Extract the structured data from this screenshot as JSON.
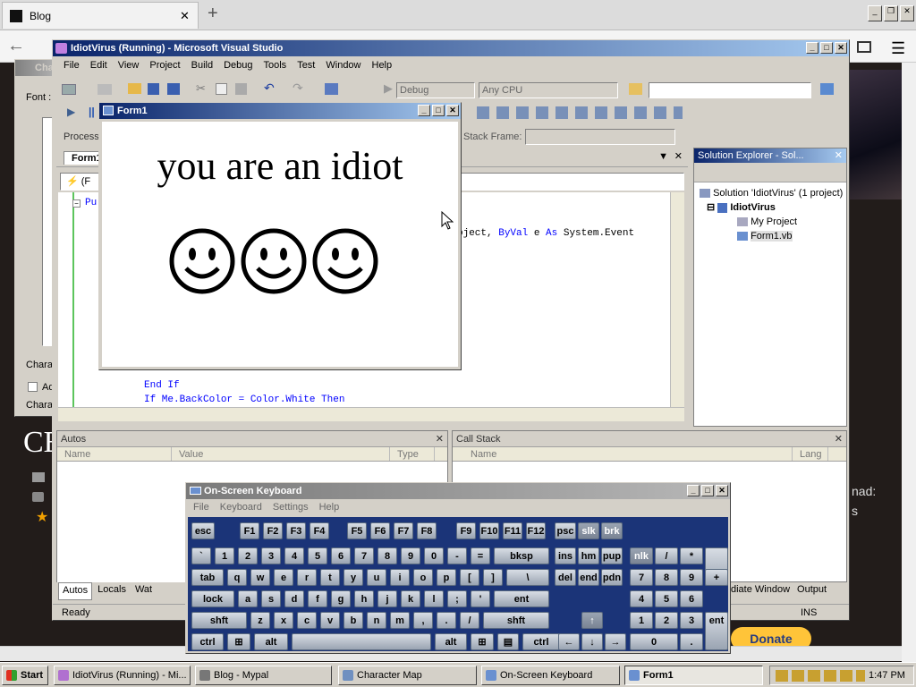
{
  "browser": {
    "tab_title": "Blog",
    "tab_close": "✕",
    "new_tab": "+",
    "back": "←",
    "win_controls": [
      "_",
      "❐",
      "✕"
    ]
  },
  "background_page": {
    "heading_fragment": "CE",
    "text_fragment_1": "nad:",
    "text_fragment_2": "s",
    "donate_label": "Donate"
  },
  "charmap": {
    "title": "Cha",
    "font_label": "Font :",
    "chars_label": "Chara",
    "adv_label": "Ad",
    "chars_label2": "Chara"
  },
  "vs": {
    "title": "IdiotVirus (Running) - Microsoft Visual Studio",
    "menu": [
      "File",
      "Edit",
      "View",
      "Project",
      "Build",
      "Debug",
      "Tools",
      "Test",
      "Window",
      "Help"
    ],
    "config": "Debug",
    "platform": "Any CPU",
    "process_label": "Process",
    "stack_frame_label": "Stack Frame:",
    "editor_tab": "Form1",
    "member_dropdown": "(F",
    "code_lines": [
      {
        "text": "Pu",
        "kw": true
      },
      {
        "text": "oject, ",
        "tail": "ByVal",
        "tail2": " e ",
        "tail3": "As",
        "tail4": " System.Event"
      },
      {
        "text": "End If"
      },
      {
        "text": "If Me.BackColor = Color.White Then"
      }
    ],
    "solution_explorer": {
      "title": "Solution Explorer - Sol...",
      "solution": "Solution 'IdiotVirus' (1 project)",
      "project": "IdiotVirus",
      "items": [
        "My Project",
        "Form1.vb"
      ]
    },
    "autos": {
      "title": "Autos",
      "columns": [
        "Name",
        "Value",
        "Type"
      ],
      "tabs": [
        "Autos",
        "Locals",
        "Wat"
      ]
    },
    "callstack": {
      "title": "Call Stack",
      "columns": [
        "Name",
        "Lang"
      ],
      "tabs": [
        "diate Window",
        "Output"
      ]
    },
    "status": "Ready",
    "ins": "INS"
  },
  "form1": {
    "title": "Form1",
    "message": "you are an idiot",
    "smileys": [
      "☺",
      "☺",
      "☺"
    ]
  },
  "osk": {
    "title": "On-Screen Keyboard",
    "menu": [
      "File",
      "Keyboard",
      "Settings",
      "Help"
    ],
    "rows": [
      [
        "esc",
        "F1",
        "F2",
        "F3",
        "F4",
        "F5",
        "F6",
        "F7",
        "F8",
        "F9",
        "F10",
        "F11",
        "F12",
        "psc",
        "slk",
        "brk"
      ],
      [
        "`",
        "1",
        "2",
        "3",
        "4",
        "5",
        "6",
        "7",
        "8",
        "9",
        "0",
        "-",
        "=",
        "bksp",
        "ins",
        "hm",
        "pup",
        "nlk",
        "/",
        "*",
        "-"
      ],
      [
        "tab",
        "q",
        "w",
        "e",
        "r",
        "t",
        "y",
        "u",
        "i",
        "o",
        "p",
        "[",
        "]",
        "\\",
        "del",
        "end",
        "pdn",
        "7",
        "8",
        "9",
        "+"
      ],
      [
        "lock",
        "a",
        "s",
        "d",
        "f",
        "g",
        "h",
        "j",
        "k",
        "l",
        ";",
        "'",
        "ent",
        "4",
        "5",
        "6"
      ],
      [
        "shft",
        "z",
        "x",
        "c",
        "v",
        "b",
        "n",
        "m",
        ",",
        ".",
        "/",
        "shft",
        "↑",
        "1",
        "2",
        "3",
        "ent"
      ],
      [
        "ctrl",
        "⊞",
        "alt",
        "",
        "alt",
        "⊞",
        "▤",
        "ctrl",
        "←",
        "↓",
        "→",
        "0",
        "."
      ]
    ]
  },
  "taskbar": {
    "start": "Start",
    "tasks": [
      "IdiotVirus (Running) - Mi...",
      "Blog - Mypal",
      "Character Map",
      "On-Screen Keyboard",
      "Form1"
    ],
    "clock": "1:47 PM"
  }
}
